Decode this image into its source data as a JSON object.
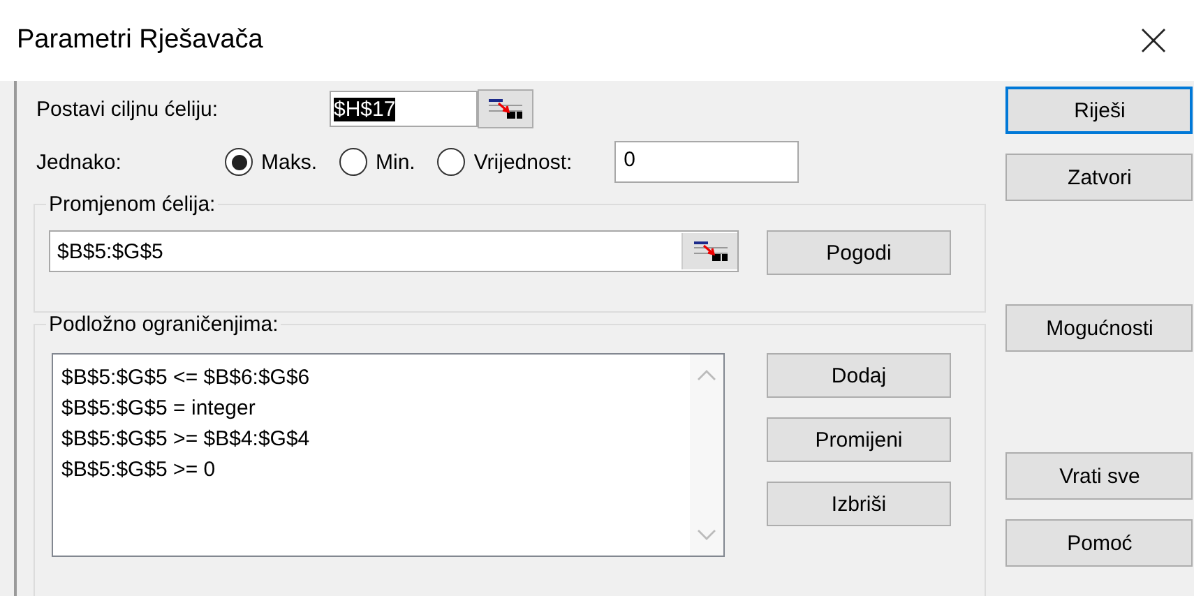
{
  "window": {
    "title": "Parametri Rješavača"
  },
  "target": {
    "label": "Postavi ciljnu ćeliju:",
    "value": "$H$17",
    "highlighted": true
  },
  "equal_to": {
    "label": "Jednako:",
    "value": "0",
    "options": [
      {
        "label": "Maks.",
        "selected": true
      },
      {
        "label": "Min.",
        "selected": false
      },
      {
        "label": "Vrijednost:",
        "selected": false
      }
    ]
  },
  "changing_cells": {
    "title": "Promjenom ćelija:",
    "value": "$B$5:$G$5",
    "button": {
      "label": "Pogodi"
    }
  },
  "constraints": {
    "title": "Podložno ograničenjima:",
    "items": [
      "$B$5:$G$5 <= $B$6:$G$6",
      "$B$5:$G$5 = integer",
      "$B$5:$G$5 >= $B$4:$G$4",
      "$B$5:$G$5 >= 0"
    ],
    "buttons": [
      {
        "label": "Dodaj"
      },
      {
        "label": "Promijeni"
      },
      {
        "label": "Izbriši"
      }
    ]
  },
  "actions_top": [
    {
      "label": "Riješi",
      "default": true
    },
    {
      "label": "Zatvori",
      "default": false
    }
  ],
  "actions_middle": [
    {
      "label": "Mogućnosti",
      "default": false
    }
  ],
  "actions_bottom": [
    {
      "label": "Vrati sve",
      "default": false
    },
    {
      "label": "Pomoć",
      "default": false
    }
  ]
}
